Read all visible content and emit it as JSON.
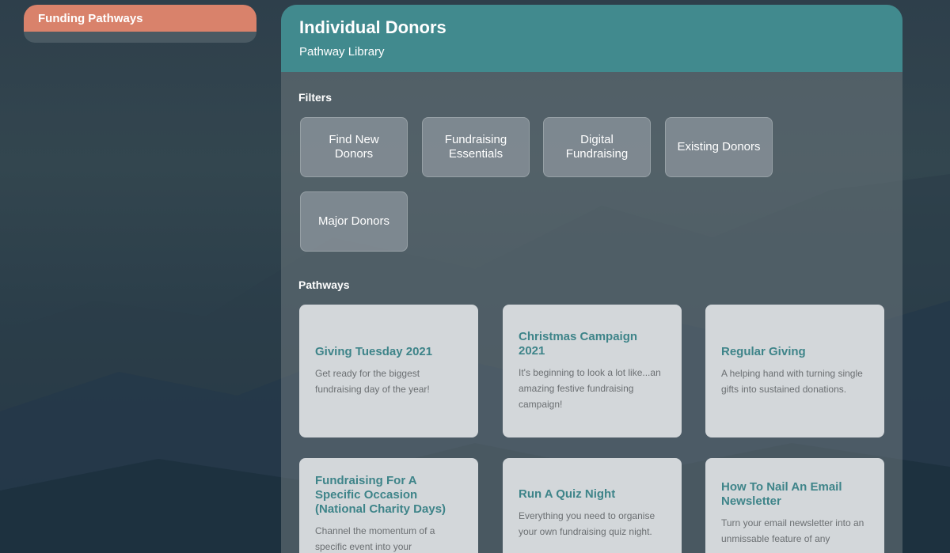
{
  "sidebar": {
    "active_item": "Funding Pathways"
  },
  "header": {
    "title": "Individual Donors",
    "subtitle": "Pathway Library"
  },
  "filters": {
    "label": "Filters",
    "items": [
      "Find New Donors",
      "Fundraising Essentials",
      "Digital Fundraising",
      "Existing Donors",
      "Major Donors"
    ]
  },
  "pathways": {
    "label": "Pathways",
    "cards": [
      {
        "title": "Giving Tuesday 2021",
        "desc": "Get ready for the biggest fundraising day of the year!"
      },
      {
        "title": "Christmas Campaign 2021",
        "desc": "It's beginning to look a lot like...an amazing festive fundraising campaign!"
      },
      {
        "title": "Regular Giving",
        "desc": "A helping hand with turning single gifts into sustained donations."
      },
      {
        "title": "Fundraising For A Specific Occasion (National Charity Days)",
        "desc": "Channel the momentum of a specific event into your"
      },
      {
        "title": "Run A Quiz Night",
        "desc": "Everything you need to organise your own fundraising quiz night."
      },
      {
        "title": "How To Nail An Email Newsletter",
        "desc": "Turn your email newsletter into an unmissable feature of any"
      }
    ]
  },
  "colors": {
    "accent_teal": "#418a8e",
    "sidebar_active": "#d9826b",
    "card_title": "#3e8489"
  }
}
